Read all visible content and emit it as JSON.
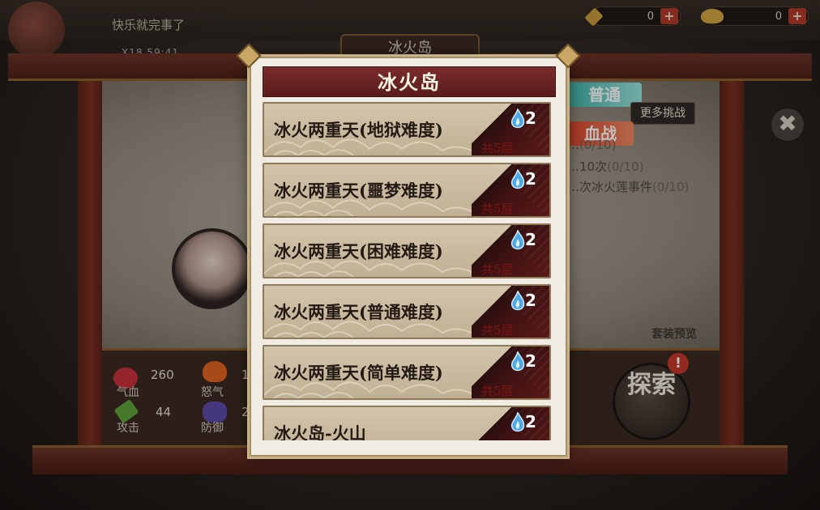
{
  "hud": {
    "player_name": "快乐就完事了",
    "player_stats": "X18   59:41",
    "currency_gem": "0",
    "currency_ingot": "0"
  },
  "map": {
    "title": "冰火岛",
    "mode_normal": "普通",
    "mode_blood": "血战",
    "more_challenge": "更多挑战",
    "tasks": [
      {
        "text": "…",
        "count": "(0/10)"
      },
      {
        "text": "…10次",
        "count": "(0/10)"
      },
      {
        "text": "…次冰火莲事件",
        "count": "(0/10)"
      }
    ],
    "stats": {
      "hp_value": "260",
      "hp_label": "气血",
      "rage_value": "1",
      "rage_label": "怒气",
      "attack_value": "44",
      "attack_label": "攻击",
      "defense_value": "2",
      "defense_label": "防御"
    },
    "preview_label": "套装预览",
    "explore_label": "探索",
    "explore_badge": "!",
    "close_symbol": "✖"
  },
  "dialog": {
    "title": "冰火岛",
    "items": [
      {
        "name": "冰火两重天(地狱难度)",
        "floors": "共5层",
        "flame_count": "2"
      },
      {
        "name": "冰火两重天(噩梦难度)",
        "floors": "共5层",
        "flame_count": "2"
      },
      {
        "name": "冰火两重天(困难难度)",
        "floors": "共5层",
        "flame_count": "2"
      },
      {
        "name": "冰火两重天(普通难度)",
        "floors": "共5层",
        "flame_count": "2"
      },
      {
        "name": "冰火两重天(简单难度)",
        "floors": "共5层",
        "flame_count": "2"
      },
      {
        "name": "冰火岛-火山",
        "floors": "",
        "flame_count": "2"
      }
    ]
  },
  "colors": {
    "title_bar": "#6a2424",
    "item_bg": "#c9bb9f",
    "ribbon": "#4a1515",
    "floors_text": "#7c1512",
    "flame": "#4fa8e6"
  },
  "icons": {
    "flame": "blue-flame-icon",
    "hp": "heart-icon",
    "rage": "fire-icon",
    "attack": "sword-icon",
    "defense": "armor-icon",
    "close": "close-icon",
    "gem": "gem-icon",
    "ingot": "gold-ingot-icon"
  }
}
